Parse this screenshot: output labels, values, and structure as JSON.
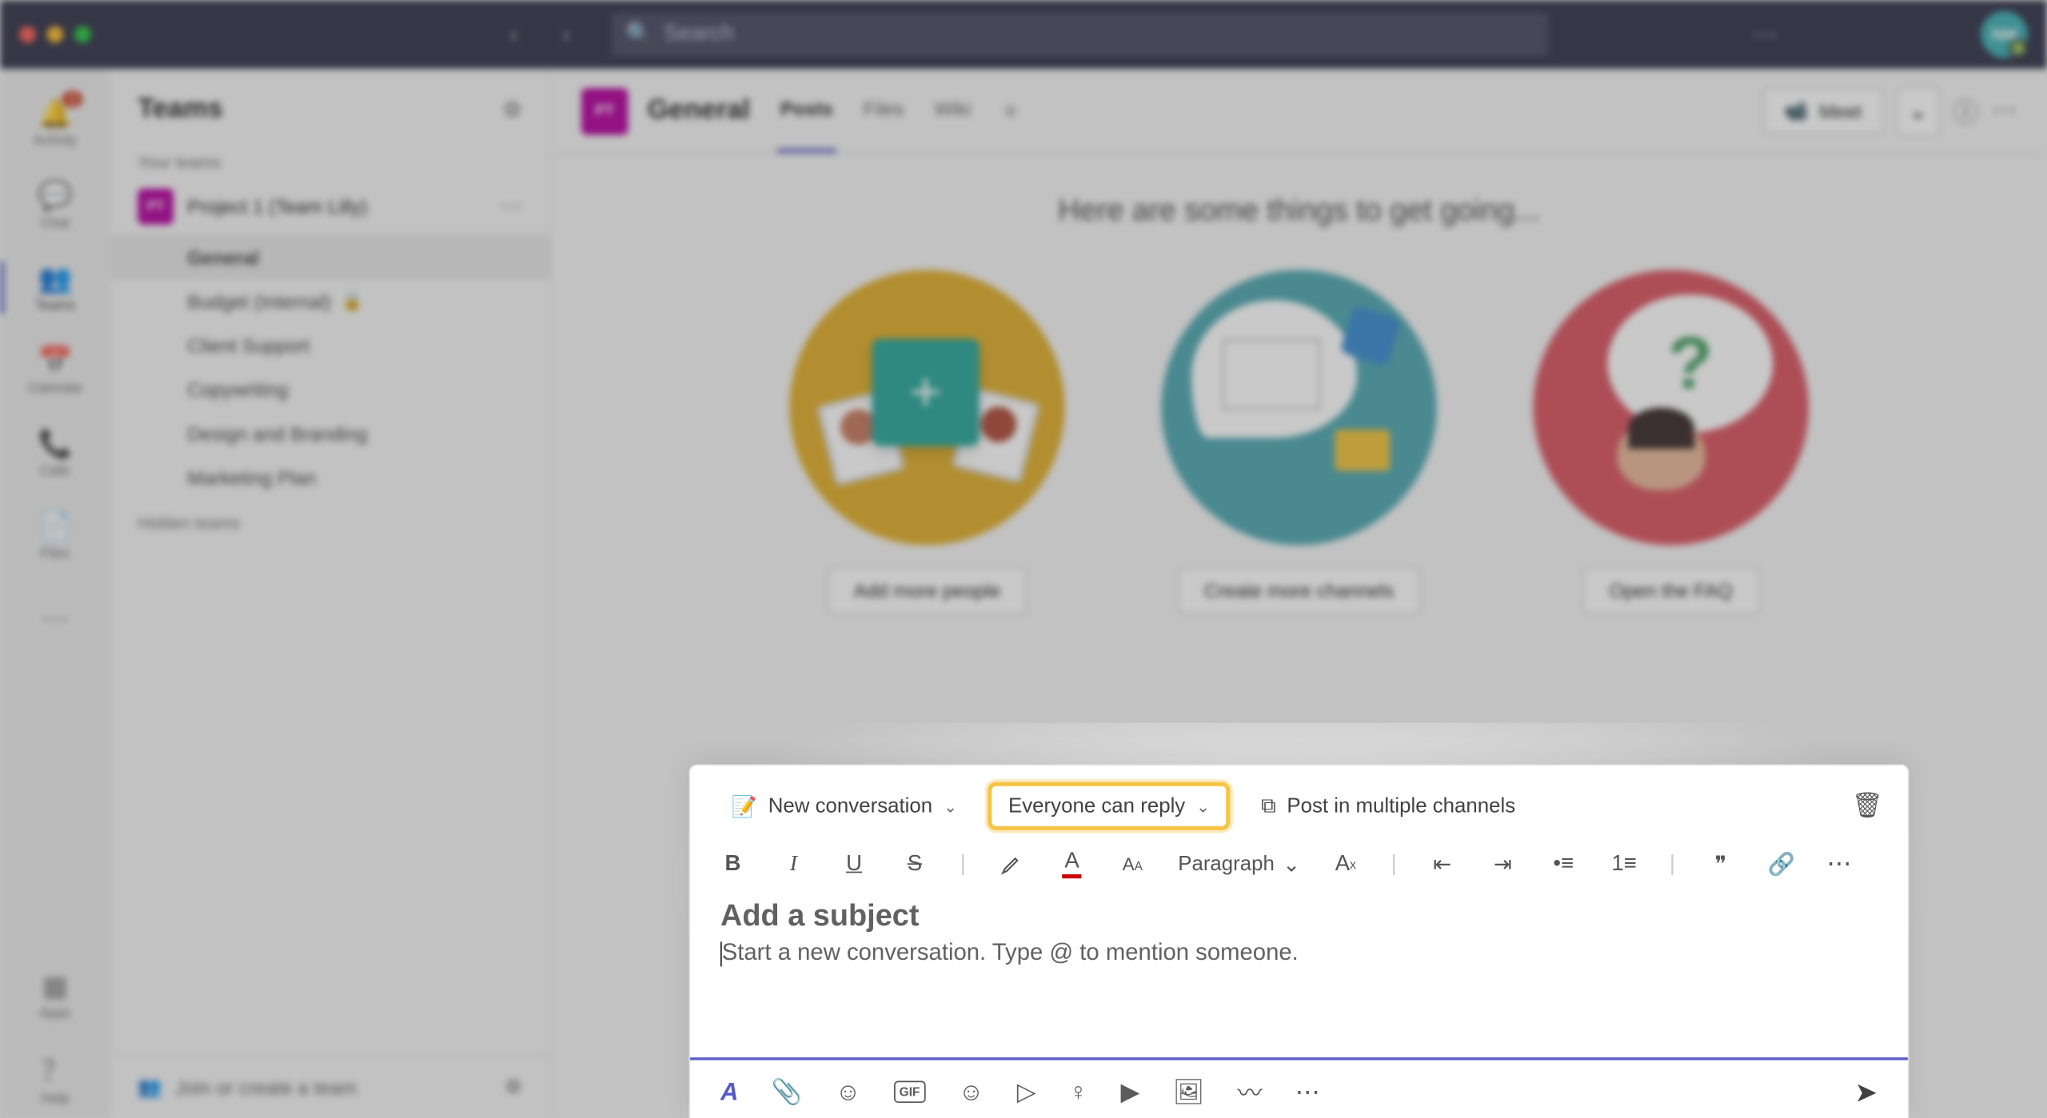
{
  "titlebar": {
    "search_placeholder": "Search",
    "avatar_initials": "NM"
  },
  "rail": {
    "items": [
      {
        "label": "Activity",
        "badge": "1"
      },
      {
        "label": "Chat"
      },
      {
        "label": "Teams"
      },
      {
        "label": "Calendar"
      },
      {
        "label": "Calls"
      },
      {
        "label": "Files"
      }
    ],
    "apps_label": "Apps",
    "help_label": "Help"
  },
  "panel": {
    "title": "Teams",
    "your_teams_label": "Your teams",
    "team": {
      "initials": "PT",
      "name": "Project 1 (Team Lilly)"
    },
    "channels": [
      {
        "name": "General",
        "active": true
      },
      {
        "name": "Budget (Internal)",
        "private": true
      },
      {
        "name": "Client Support"
      },
      {
        "name": "Copywriting"
      },
      {
        "name": "Design and Branding"
      },
      {
        "name": "Marketing Plan"
      }
    ],
    "hidden_label": "Hidden teams",
    "join_label": "Join or create a team"
  },
  "chanbar": {
    "avatar_initials": "PT",
    "title": "General",
    "tabs": [
      {
        "label": "Posts",
        "active": true
      },
      {
        "label": "Files"
      },
      {
        "label": "Wiki"
      }
    ],
    "meet_label": "Meet"
  },
  "welcome": {
    "heading": "Here are some things to get going...",
    "cards": [
      {
        "button": "Add more people"
      },
      {
        "button": "Create more channels"
      },
      {
        "button": "Open the FAQ"
      }
    ]
  },
  "compose": {
    "new_conversation_label": "New conversation",
    "reply_scope_label": "Everyone can reply",
    "post_multiple_label": "Post in multiple channels",
    "paragraph_label": "Paragraph",
    "subject_placeholder": "Add a subject",
    "body_placeholder": "Start a new conversation. Type @ to mention someone.",
    "gif_label": "GIF"
  }
}
